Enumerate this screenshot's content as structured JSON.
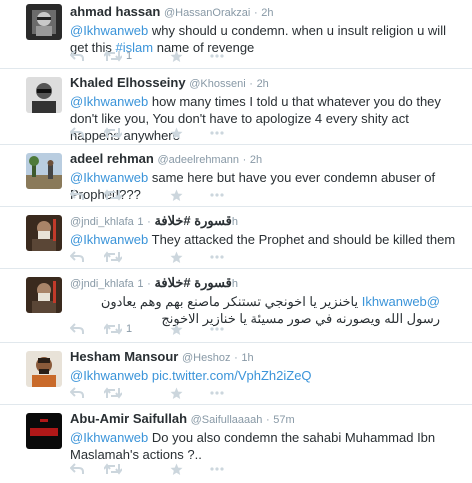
{
  "accent": "#3b94d9",
  "icons": {
    "reply": "reply-icon",
    "retweet": "retweet-icon",
    "favorite": "star-icon",
    "more": "more-icon"
  },
  "tweets": [
    {
      "name": "ahmad hassan",
      "handle": "@HassanOrakzai",
      "time": "2h",
      "text_parts": [
        "",
        "@Ikhwanweb",
        " why should u condemn. when u insult religion u will get this ",
        "#islam",
        " name of revenge"
      ],
      "retweets": "1"
    },
    {
      "name": "Khaled Elhosseiny",
      "handle": "@Khosseni",
      "time": "2h",
      "text_parts": [
        "",
        "@Ikhwanweb",
        " how many times I told u that whatever you do they don't like you, You don't have to apologize 4 every shity act happens anywhere"
      ]
    },
    {
      "name": "adeel rehman",
      "handle": "@adeelrehmann",
      "time": "2h",
      "text_parts": [
        "",
        "@Ikhwanweb",
        " same here but have you ever condemn abuser of Prophet!???"
      ]
    },
    {
      "name": "قسورة #خلافة",
      "handle": "@jndi_khlafa",
      "time": "1h",
      "text_parts": [
        "",
        "@Ikhwanweb",
        " They attacked the Prophet and should be killed them"
      ]
    },
    {
      "name": "قسورة #خلافة",
      "handle": "@jndi_khlafa",
      "time": "1h",
      "mention": "@Ikhwanweb",
      "rtl_text": "ياخنزير يا اخونجي تستنكر ماصنع بهم وهم يعادون رسول الله ويصورنه في صور مسيئة يا خنازير الاخونج",
      "retweets": "1"
    },
    {
      "name": "Hesham Mansour",
      "handle": "@Heshoz",
      "time": "1h",
      "text_parts": [
        "",
        "@Ikhwanweb",
        " ",
        "pic.twitter.com/VphZh2iZeQ",
        ""
      ]
    },
    {
      "name": "Abu-Amir Saifullah",
      "handle": "@Saifullaaaah",
      "time": "57m",
      "text_parts": [
        "",
        "@Ikhwanweb",
        " Do you also condemn the sahabi Muhammad Ibn Maslamah's actions ?.."
      ]
    }
  ]
}
